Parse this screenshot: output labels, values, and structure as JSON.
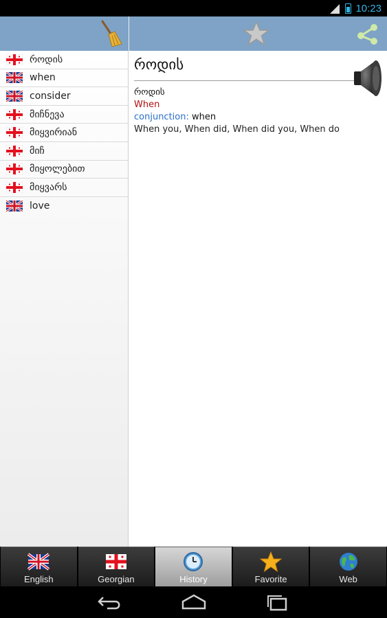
{
  "status_bar": {
    "time": "10:23",
    "network": "3G"
  },
  "toolbar": {
    "clear_history_icon": "broom-icon",
    "favorite_icon": "star-icon",
    "share_icon": "share-icon"
  },
  "history": [
    {
      "flag": "georgia",
      "label": "როდის"
    },
    {
      "flag": "uk",
      "label": "when"
    },
    {
      "flag": "uk",
      "label": "consider"
    },
    {
      "flag": "georgia",
      "label": "მიჩნევა"
    },
    {
      "flag": "georgia",
      "label": "მიყვირიან"
    },
    {
      "flag": "georgia",
      "label": "მიჩ"
    },
    {
      "flag": "georgia",
      "label": "მიყოლებით"
    },
    {
      "flag": "georgia",
      "label": "მიყვარს"
    },
    {
      "flag": "uk",
      "label": "love"
    }
  ],
  "entry": {
    "title": "როდის",
    "headword": "როდის",
    "translation": "When",
    "pos": "conjunction:",
    "pos_meaning": " when",
    "phrases": "When you, When did, When did you, When do"
  },
  "tabs": [
    {
      "label": "English",
      "icon": "uk-flag-icon",
      "active": false
    },
    {
      "label": "Georgian",
      "icon": "georgia-flag-icon",
      "active": false
    },
    {
      "label": "History",
      "icon": "clock-icon",
      "active": true
    },
    {
      "label": "Favorite",
      "icon": "star-icon",
      "active": false
    },
    {
      "label": "Web",
      "icon": "globe-icon",
      "active": false
    }
  ],
  "colors": {
    "toolbar": "#7ea3c6",
    "accent": "#33b5e5",
    "translation": "#b01010",
    "pos": "#2a6fc9"
  }
}
